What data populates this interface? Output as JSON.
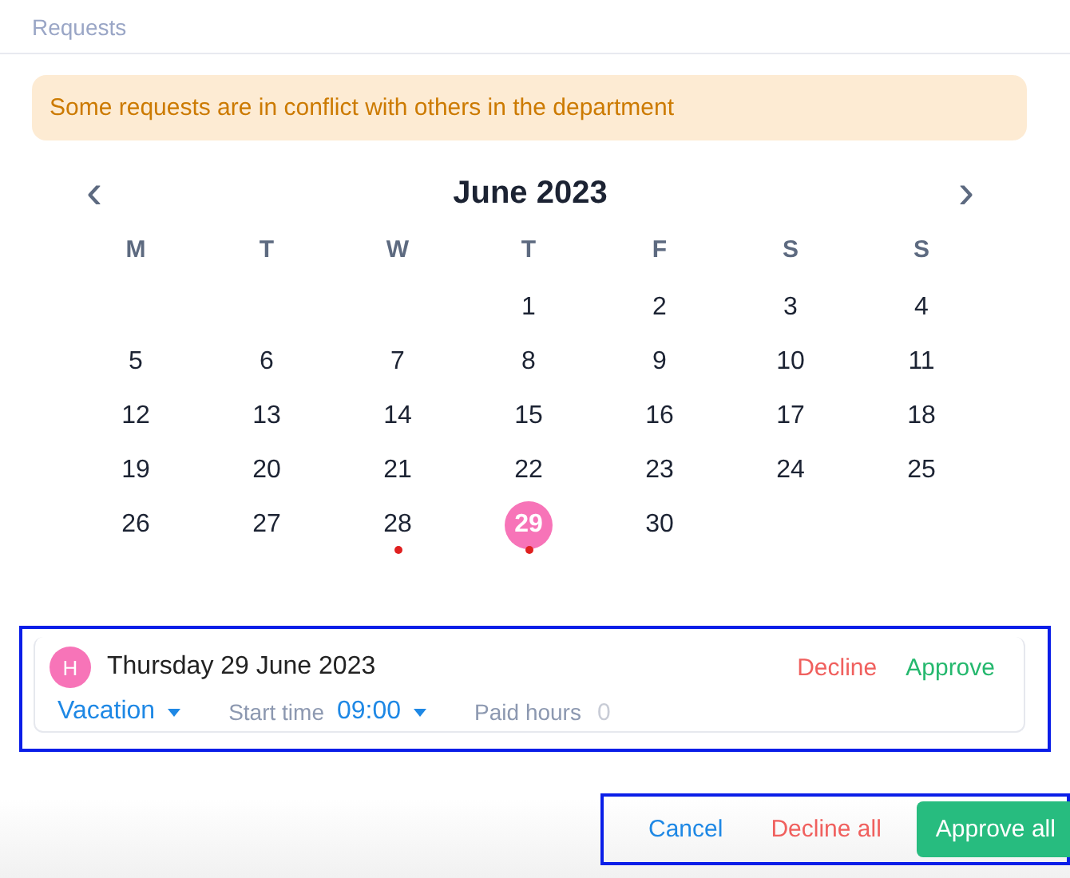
{
  "header": {
    "title": "Requests"
  },
  "alert": {
    "text": "Some requests are in conflict with others in the department"
  },
  "calendar": {
    "prev": "‹",
    "next": "›",
    "month": "June 2023",
    "weekdays": [
      "M",
      "T",
      "W",
      "T",
      "F",
      "S",
      "S"
    ],
    "weeks": [
      [
        {
          "kind": "blank"
        },
        {
          "kind": "blank"
        },
        {
          "kind": "blank"
        },
        {
          "kind": "day",
          "day": "1",
          "selected": false,
          "conflict": false
        },
        {
          "day": "2",
          "selected": false,
          "conflict": false
        },
        {
          "day": "3",
          "selected": false,
          "conflict": false
        },
        {
          "day": "4",
          "selected": false,
          "conflict": false
        }
      ],
      [
        {
          "day": "5",
          "selected": false,
          "conflict": false
        },
        {
          "day": "6",
          "selected": false,
          "conflict": false
        },
        {
          "day": "7",
          "selected": false,
          "conflict": false
        },
        {
          "day": "8",
          "selected": false,
          "conflict": false
        },
        {
          "day": "9",
          "selected": false,
          "conflict": false
        },
        {
          "day": "10",
          "selected": false,
          "conflict": false
        },
        {
          "day": "11",
          "selected": false,
          "conflict": false
        }
      ],
      [
        {
          "day": "12",
          "selected": false,
          "conflict": false
        },
        {
          "day": "13",
          "selected": false,
          "conflict": false
        },
        {
          "day": "14",
          "selected": false,
          "conflict": false
        },
        {
          "day": "15",
          "selected": false,
          "conflict": false
        },
        {
          "day": "16",
          "selected": false,
          "conflict": false
        },
        {
          "day": "17",
          "selected": false,
          "conflict": false
        },
        {
          "day": "18",
          "selected": false,
          "conflict": false
        }
      ],
      [
        {
          "day": "19",
          "selected": false,
          "conflict": false
        },
        {
          "day": "20",
          "selected": false,
          "conflict": false
        },
        {
          "day": "21",
          "selected": false,
          "conflict": false
        },
        {
          "day": "22",
          "selected": false,
          "conflict": false
        },
        {
          "day": "23",
          "selected": false,
          "conflict": false
        },
        {
          "day": "24",
          "selected": false,
          "conflict": false
        },
        {
          "day": "25",
          "selected": false,
          "conflict": false
        }
      ],
      [
        {
          "day": "26",
          "selected": false,
          "conflict": false
        },
        {
          "day": "27",
          "selected": false,
          "conflict": false
        },
        {
          "day": "28",
          "selected": false,
          "conflict": true
        },
        {
          "day": "29",
          "selected": true,
          "conflict": true
        },
        {
          "day": "30",
          "selected": false,
          "conflict": false
        },
        {
          "kind": "blank"
        },
        {
          "kind": "blank"
        }
      ]
    ]
  },
  "request": {
    "initial": "H",
    "date": "Thursday 29 June 2023",
    "decline": "Decline",
    "approve": "Approve",
    "type": "Vacation",
    "start_label": "Start time",
    "start_time": "09:00",
    "paid_label": "Paid hours",
    "paid_value": "0"
  },
  "footer": {
    "cancel": "Cancel",
    "decline_all": "Decline all",
    "approve_all": "Approve all"
  }
}
